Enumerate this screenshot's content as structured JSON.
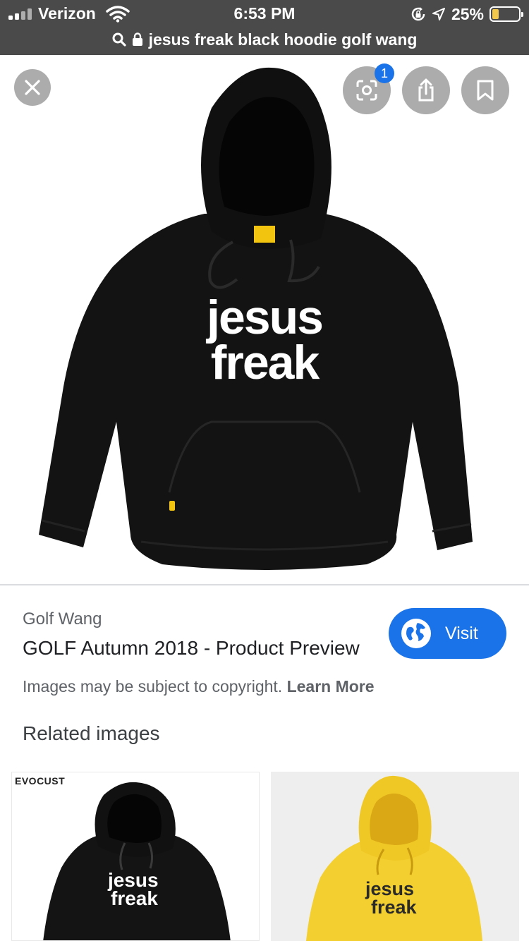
{
  "status_bar": {
    "carrier": "Verizon",
    "time": "6:53 PM",
    "battery_percent": "25%",
    "battery_level": 0.25,
    "icons": [
      "signal-icon",
      "wifi-icon",
      "rotation-lock-icon",
      "location-icon",
      "battery-icon"
    ]
  },
  "url_bar": {
    "query": "jesus freak black hoodie golf wang",
    "icons": [
      "search-icon",
      "lock-icon"
    ]
  },
  "hero": {
    "print_line1": "jesus",
    "print_line2": "freak",
    "lens_badge_count": "1",
    "icons": [
      "close-icon",
      "lens-icon",
      "share-icon",
      "bookmark-icon"
    ]
  },
  "result": {
    "source_name": "Golf Wang",
    "title": "GOLF Autumn 2018 - Product Preview",
    "visit_label": "Visit",
    "copyright_text": "Images may be subject to copyright.",
    "learn_more_label": "Learn More"
  },
  "related": {
    "heading": "Related images",
    "items": [
      {
        "brand_watermark": "EVOCUST",
        "print_line1": "jesus",
        "print_line2": "freak",
        "color": "#141414"
      },
      {
        "print_line1": "jesus",
        "print_line2": "freak",
        "color": "#f3cf2f"
      }
    ]
  },
  "colors": {
    "top_bar": "#4a4a4a",
    "accent": "#1a73e8",
    "hoodie_black": "#131313",
    "hoodie_yellow": "#f3cf2f"
  }
}
